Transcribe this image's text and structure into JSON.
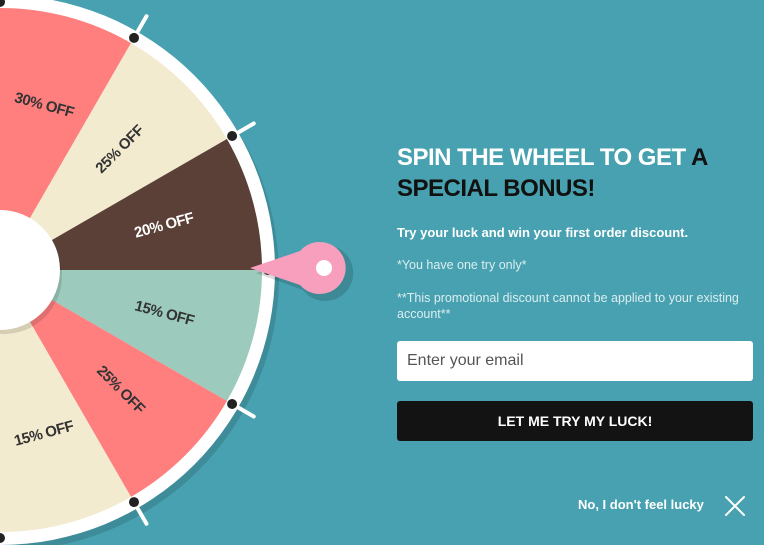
{
  "wheel": {
    "segments": [
      {
        "label": "",
        "color": "#5b4038",
        "text_color": "#ffffff"
      },
      {
        "label": "",
        "color": "#9ccbbd",
        "text_color": "#333333"
      },
      {
        "label": "30% OFF",
        "color": "#ff7f7f",
        "text_color": "#333333"
      },
      {
        "label": "25% OFF",
        "color": "#f3ebcf",
        "text_color": "#333333"
      },
      {
        "label": "20% OFF",
        "color": "#5b4038",
        "text_color": "#ffffff"
      },
      {
        "label": "15% OFF",
        "color": "#9ccbbd",
        "text_color": "#333333"
      },
      {
        "label": "25% OFF",
        "color": "#ff7f7f",
        "text_color": "#333333"
      },
      {
        "label": "15% OFF",
        "color": "#f3ebcf",
        "text_color": "#333333"
      },
      {
        "label": "",
        "color": "#5b4038",
        "text_color": "#ffffff"
      }
    ],
    "pointer_color": "#f79fbd"
  },
  "popup": {
    "title_highlight": "SPIN THE WHEEL TO GET",
    "title_rest": "A SPECIAL BONUS!",
    "subtitle": "Try your luck and win your first order discount.",
    "note_one_try": "*You have one try only*",
    "note_disclaimer": "**This promotional discount cannot be applied to your existing account**",
    "email_placeholder": "Enter your email",
    "submit_label": "LET ME TRY MY LUCK!",
    "decline_label": "No, I don't feel lucky",
    "close_icon": "close-icon"
  },
  "colors": {
    "background": "#48a1b0",
    "button": "#131313",
    "title_highlight": "#ffffff",
    "title_rest": "#111111"
  }
}
